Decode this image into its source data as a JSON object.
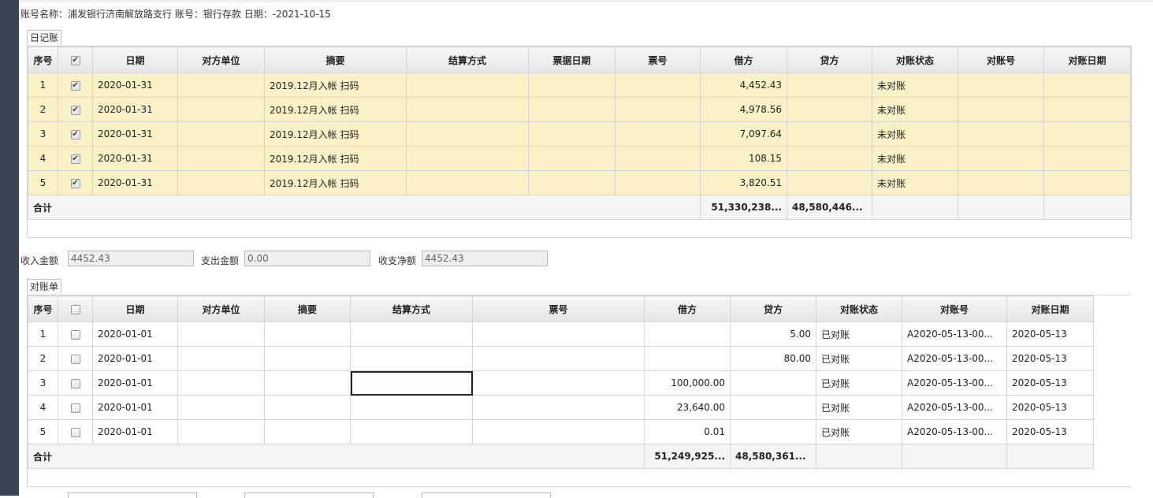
{
  "header": {
    "account_label": "账号名称：",
    "account_name": "浦发银行济南解放路支行",
    "account_no_label": "账号：",
    "account_no": "银行存款",
    "date_label": "日期：",
    "date_value": "-2021-10-15"
  },
  "journal": {
    "tab_label": "日记账",
    "columns": [
      "序号",
      "",
      "日期",
      "对方单位",
      "摘要",
      "结算方式",
      "票据日期",
      "票号",
      "借方",
      "贷方",
      "对账状态",
      "对账号",
      "对账日期"
    ],
    "rows": [
      {
        "no": "1",
        "checked": true,
        "date": "2020-01-31",
        "counterparty": "",
        "summary": "2019.12月入帐 扫码",
        "method": "",
        "bill_date": "",
        "bill_no": "",
        "debit": "4,452.43",
        "credit": "",
        "status": "未对账",
        "recon_no": "",
        "recon_date": ""
      },
      {
        "no": "2",
        "checked": true,
        "date": "2020-01-31",
        "counterparty": "",
        "summary": "2019.12月入帐 扫码",
        "method": "",
        "bill_date": "",
        "bill_no": "",
        "debit": "4,978.56",
        "credit": "",
        "status": "未对账",
        "recon_no": "",
        "recon_date": ""
      },
      {
        "no": "3",
        "checked": true,
        "date": "2020-01-31",
        "counterparty": "",
        "summary": "2019.12月入帐 扫码",
        "method": "",
        "bill_date": "",
        "bill_no": "",
        "debit": "7,097.64",
        "credit": "",
        "status": "未对账",
        "recon_no": "",
        "recon_date": ""
      },
      {
        "no": "4",
        "checked": true,
        "date": "2020-01-31",
        "counterparty": "",
        "summary": "2019.12月入帐 扫码",
        "method": "",
        "bill_date": "",
        "bill_no": "",
        "debit": "108.15",
        "credit": "",
        "status": "未对账",
        "recon_no": "",
        "recon_date": ""
      },
      {
        "no": "5",
        "checked": true,
        "date": "2020-01-31",
        "counterparty": "",
        "summary": "2019.12月入帐 扫码",
        "method": "",
        "bill_date": "",
        "bill_no": "",
        "debit": "3,820.51",
        "credit": "",
        "status": "未对账",
        "recon_no": "",
        "recon_date": ""
      }
    ],
    "total_label": "合计",
    "total_debit": "51,330,238...",
    "total_credit": "48,580,446..."
  },
  "summary": {
    "income_label": "收入金额",
    "income_value": "4452.43",
    "expense_label": "支出金额",
    "expense_value": "0.00",
    "net_label": "收支净额",
    "net_value": "4452.43"
  },
  "statement": {
    "tab_label": "对账单",
    "columns": [
      "序号",
      "",
      "日期",
      "对方单位",
      "摘要",
      "结算方式",
      "票号",
      "借方",
      "贷方",
      "对账状态",
      "对账号",
      "对账日期"
    ],
    "rows": [
      {
        "no": "1",
        "checked": false,
        "date": "2020-01-01",
        "counterparty": "",
        "summary": "",
        "method": "",
        "bill_no": "",
        "debit": "",
        "credit": "5.00",
        "status": "已对账",
        "recon_no": "A2020-05-13-00...",
        "recon_date": "2020-05-13"
      },
      {
        "no": "2",
        "checked": false,
        "date": "2020-01-01",
        "counterparty": "",
        "summary": "",
        "method": "",
        "bill_no": "",
        "debit": "",
        "credit": "80.00",
        "status": "已对账",
        "recon_no": "A2020-05-13-00...",
        "recon_date": "2020-05-13"
      },
      {
        "no": "3",
        "checked": false,
        "date": "2020-01-01",
        "counterparty": "",
        "summary": "",
        "method": "",
        "bill_no": "",
        "debit": "100,000.00",
        "credit": "",
        "status": "已对账",
        "recon_no": "A2020-05-13-00...",
        "recon_date": "2020-05-13"
      },
      {
        "no": "4",
        "checked": false,
        "date": "2020-01-01",
        "counterparty": "",
        "summary": "",
        "method": "",
        "bill_no": "",
        "debit": "23,640.00",
        "credit": "",
        "status": "已对账",
        "recon_no": "A2020-05-13-00...",
        "recon_date": "2020-05-13"
      },
      {
        "no": "5",
        "checked": false,
        "date": "2020-01-01",
        "counterparty": "",
        "summary": "",
        "method": "",
        "bill_no": "",
        "debit": "0.01",
        "credit": "",
        "status": "已对账",
        "recon_no": "A2020-05-13-00...",
        "recon_date": "2020-05-13"
      }
    ],
    "total_label": "合计",
    "total_debit": "51,249,925...",
    "total_credit": "48,580,361..."
  },
  "icons": {
    "check_mark": "✔"
  },
  "colors": {
    "selected_row": "#fbf1c7",
    "sidebar": "#3b4452"
  }
}
